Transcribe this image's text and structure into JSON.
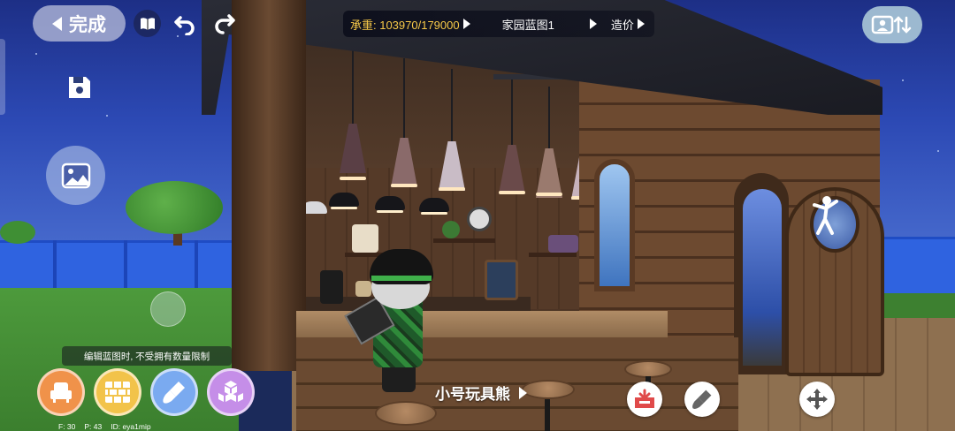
{
  "toolbar": {
    "done_label": "完成",
    "book_icon": "book-icon",
    "undo_icon": "undo-icon",
    "redo_icon": "redo-icon",
    "save_icon": "save-icon",
    "photo_icon": "photo-icon",
    "player_switch_icon": "player-switch-icon"
  },
  "status_bar": {
    "load_label": "承重: 103970/179000",
    "blueprint_name": "家园蓝图1",
    "cost_label": "造价"
  },
  "hint_text": "编辑蓝图时, 不受拥有数量限制",
  "build_tools": [
    {
      "name": "furniture",
      "icon": "armchair-icon"
    },
    {
      "name": "bricks",
      "icon": "brick-wall-icon"
    },
    {
      "name": "paint",
      "icon": "paint-brush-icon"
    },
    {
      "name": "blocks",
      "icon": "cubes-icon"
    }
  ],
  "stats": {
    "f": "F: 30",
    "p": "P: 43",
    "id": "ID: eya1mip"
  },
  "selected_item": {
    "name": "小号玩具熊"
  },
  "actions": [
    {
      "name": "remove",
      "icon": "remove-box-icon"
    },
    {
      "name": "paint",
      "icon": "paint-brush-icon"
    },
    {
      "name": "move",
      "icon": "move-arrows-icon"
    }
  ],
  "colors": {
    "accent_gold": "#f7c948",
    "tool_orange": "#f0924a",
    "tool_yellow": "#f2c34a",
    "tool_blue": "#7aaaf0",
    "tool_purple": "#c58ee8",
    "remove_red": "#e04a4a"
  }
}
